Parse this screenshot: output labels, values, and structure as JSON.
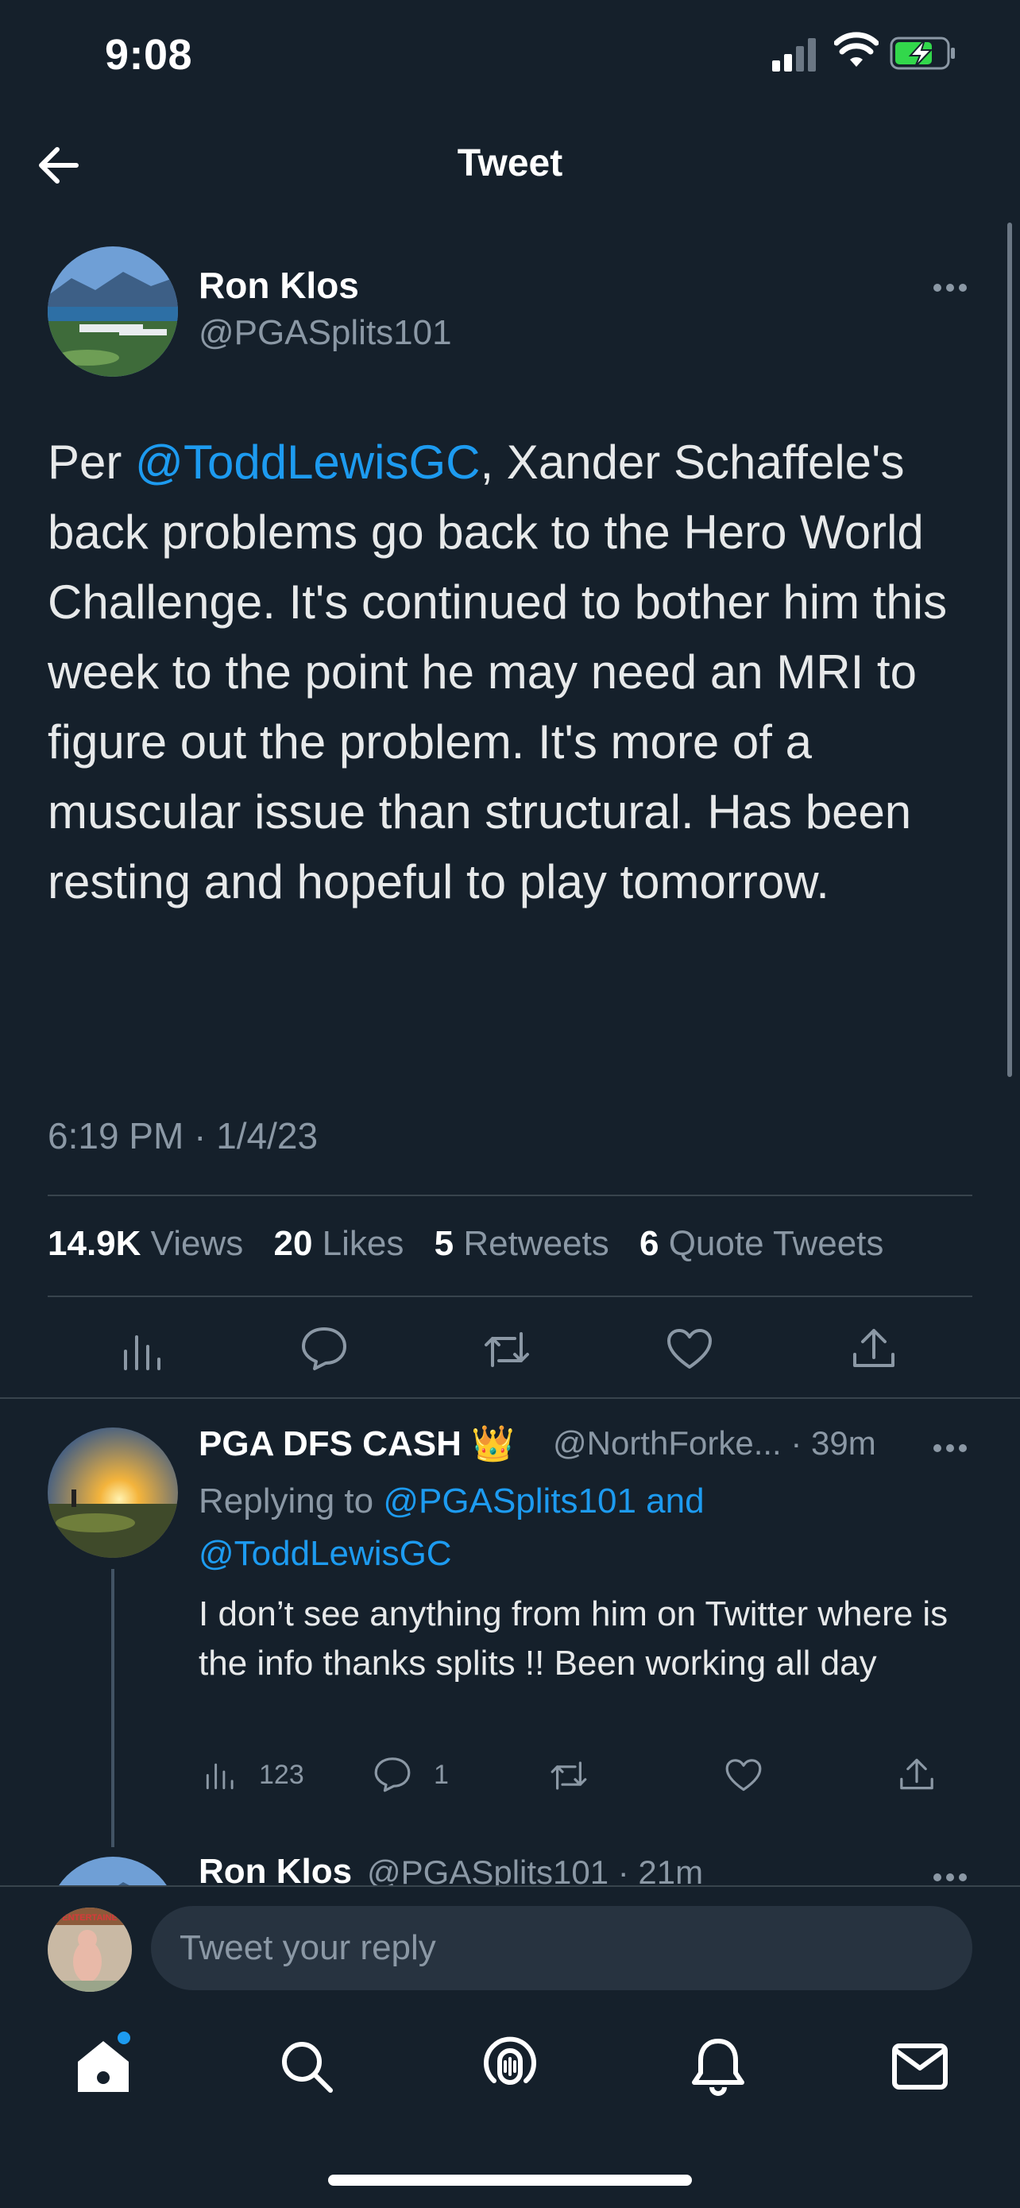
{
  "status_bar": {
    "time": "9:08"
  },
  "header": {
    "title": "Tweet"
  },
  "tweet": {
    "author_name": "Ron Klos",
    "author_handle": "@PGASplits101",
    "text_prefix": "Per ",
    "mention": "@ToddLewisGC",
    "text_rest": ", Xander Schaffele's back problems go back to the Hero World Challenge. It's continued to bother him this week to the point he may need an MRI to figure out the problem. It's more of a muscular issue than structural. Has been resting and hopeful to play tomorrow.",
    "timestamp": "6:19 PM · 1/4/23",
    "stats": {
      "views_count": "14.9K",
      "views_label": "Views",
      "likes_count": "20",
      "likes_label": "Likes",
      "retweets_count": "5",
      "retweets_label": "Retweets",
      "quotes_count": "6",
      "quotes_label": "Quote Tweets"
    }
  },
  "reply": {
    "author_name": "PGA DFS CASH 👑",
    "author_handle_time": "@NorthForke... · 39m",
    "replying_label": "Replying to ",
    "replying_targets": "@PGASplits101 and @ToddLewisGC",
    "text": "I don’t see anything from him on Twitter where is the info thanks splits !! Been working all day",
    "views": "123",
    "replies": "1"
  },
  "next_reply": {
    "author_name": "Ron Klos",
    "author_handle_time": "@PGASplits101 · 21m"
  },
  "composer": {
    "placeholder": "Tweet your reply"
  },
  "colors": {
    "background": "#15202B",
    "accent": "#1D9BF0",
    "muted": "#8B98A5",
    "divider": "#38444D"
  },
  "icons": {
    "back": "arrow-left-icon",
    "more": "more-horizontal-icon",
    "analytics": "analytics-icon",
    "reply": "reply-icon",
    "retweet": "retweet-icon",
    "like": "heart-icon",
    "share": "share-icon",
    "tabs": [
      "home-icon",
      "search-icon",
      "spaces-icon",
      "notifications-icon",
      "messages-icon"
    ]
  }
}
